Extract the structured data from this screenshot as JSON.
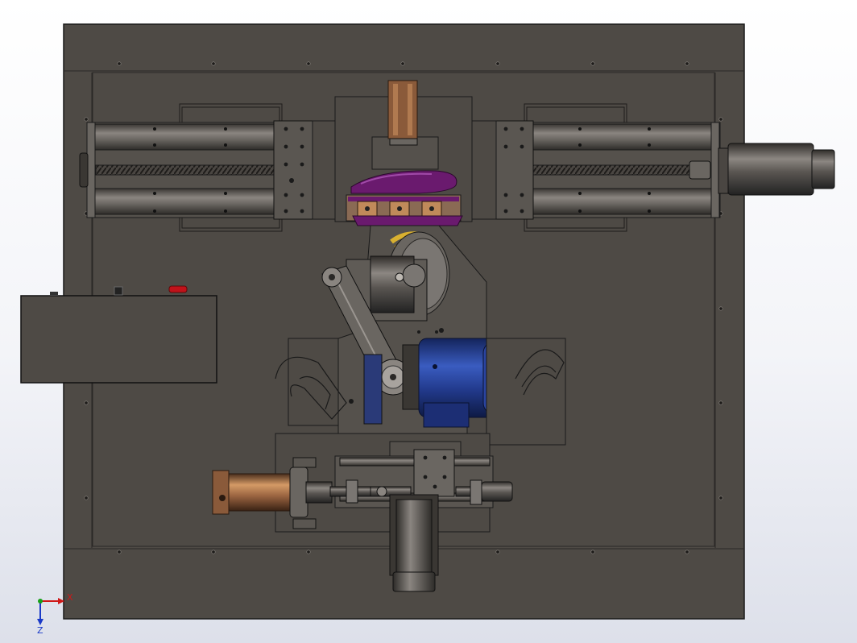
{
  "viewport": {
    "background": "#f3f4f8"
  },
  "colors": {
    "frame": "#4e4a45",
    "frame_edge": "#1a1a1a",
    "plate": "#545049",
    "rail": "#5f5b56",
    "rail_light": "#8a8580",
    "motor_blue": "#223a8c",
    "motor_blue_light": "#3a5cc0",
    "purple": "#6a1a6e",
    "copper": "#8a5a3a",
    "copper_light": "#c08a5a",
    "red_button": "#c0121a",
    "yellow": "#d8b030",
    "gray_metal": "#7a7672",
    "axis_x": "#d01818",
    "axis_y": "#1a3ac8"
  },
  "triad": {
    "x_label": "X",
    "y_label": "Z"
  }
}
